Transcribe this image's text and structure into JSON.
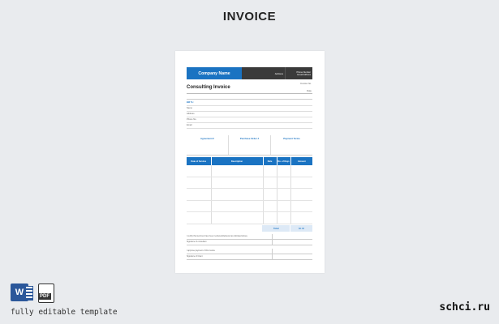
{
  "page": {
    "title": "INVOICE",
    "tagline": "fully editable template",
    "brand": "schci.ru"
  },
  "invoice": {
    "company_name": "Company Name",
    "address": "Address",
    "phone": "Phone Number",
    "email": "Email Address",
    "title": "Consulting Invoice",
    "invoice_no_label": "Invoice No.",
    "date_label": "Date",
    "bill_to_label": "Bill To:",
    "bill_fields": [
      "Name",
      "Address",
      "Phone No.",
      "Email"
    ],
    "meta": {
      "agreement": "Agreement #",
      "purchase_order": "Purchase Order #",
      "payment_terms": "Payment Terms"
    },
    "columns": [
      "Date of Service",
      "Description",
      "Rate",
      "No. of Days",
      "Amount"
    ],
    "total_label": "Total",
    "total_value": "$0.00",
    "cert_lines": [
      "I certify that services have been rendered/delivered as indicated above.",
      "Signature of consultant",
      "I approve payment of this invoice",
      "Signature of Client"
    ]
  },
  "icons": [
    "word-icon",
    "pdf-icon"
  ],
  "colors": {
    "accent": "#1a73c2",
    "dark": "#3a3a3a",
    "background": "#e9ebee"
  }
}
